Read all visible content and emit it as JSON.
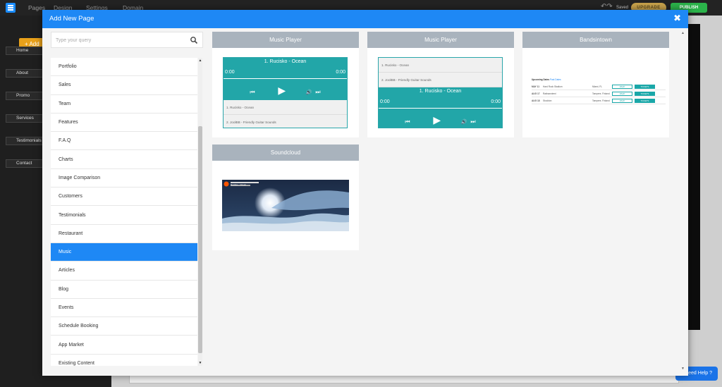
{
  "topbar": {
    "nav_items": [
      "Pages",
      "Design",
      "Settings",
      "Domain"
    ],
    "saved": "Saved",
    "upgrade": "UPGRADE",
    "publish": "PUBLISH"
  },
  "leftpanel": {
    "add_label": "+ Add",
    "pages": [
      "Home",
      "About",
      "Promo",
      "Services",
      "Testimonials",
      "Contact"
    ]
  },
  "help": "Need Help ?",
  "modal": {
    "title": "Add New Page",
    "close": "✖",
    "search_placeholder": "Type your query",
    "categories": [
      "Portfolio",
      "Sales",
      "Team",
      "Features",
      "F.A.Q",
      "Charts",
      "Image Comparison",
      "Customers",
      "Testimonials",
      "Restaurant",
      "Music",
      "Articles",
      "Blog",
      "Events",
      "Schedule Booking",
      "App Market",
      "Existing Content"
    ],
    "active_category": "Music",
    "templates": [
      {
        "title": "Music Player"
      },
      {
        "title": "Music Player"
      },
      {
        "title": "Bandsintown"
      },
      {
        "title": "Soundcloud"
      }
    ],
    "player": {
      "track": "1. Rucisko - Ocean",
      "time_start": "0:00",
      "time_end": "0:00",
      "playlist": [
        "1. Rucisko - Ocean",
        "2. JoolBB - Friendly Guitar Sounds"
      ]
    },
    "bandsintown": {
      "heading": "Upcoming Dates",
      "heading_link": "Past Dates",
      "events": [
        {
          "date": "MAY 11",
          "venue": "Hard Rock Stadium",
          "location": "Miami, FL",
          "btn1": "RSVP",
          "btn2": "TICKETS"
        },
        {
          "date": "AUG 17",
          "venue": "Ratinanniemi",
          "location": "Tampere, Finland",
          "btn1": "RSVP",
          "btn2": "TICKETS"
        },
        {
          "date": "AUG 18",
          "venue": "Stockton",
          "location": "Tampere, Finland",
          "btn1": "RSVP",
          "btn2": "TICKETS"
        }
      ]
    },
    "soundcloud": {
      "caption": "Rucisko - Ocean"
    }
  }
}
